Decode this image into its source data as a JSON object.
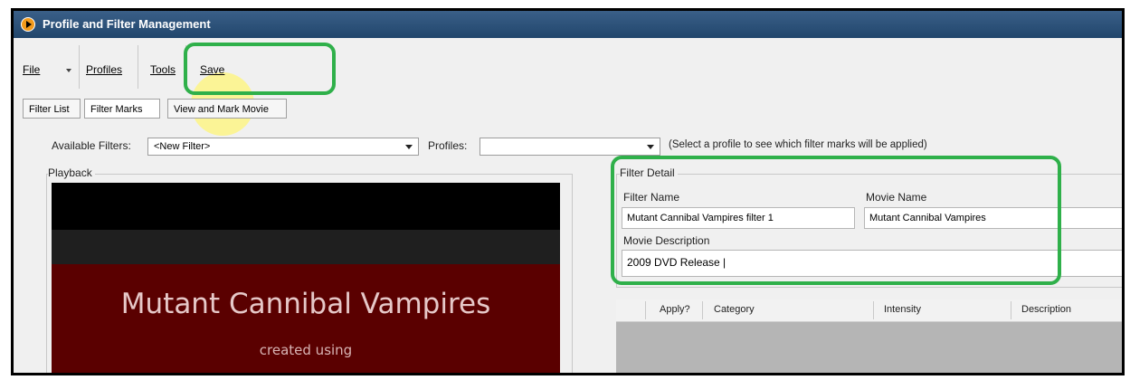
{
  "window": {
    "title": "Profile and Filter Management"
  },
  "menu": {
    "file": "File",
    "profiles": "Profiles",
    "tools": "Tools",
    "save": "Save"
  },
  "tabs": [
    {
      "label": "Filter List"
    },
    {
      "label": "Filter Marks"
    },
    {
      "label": "View and Mark Movie"
    }
  ],
  "filters": {
    "available_label": "Available Filters:",
    "available_value": "<New Filter>",
    "profiles_label": "Profiles:",
    "profiles_value": "",
    "hint": "(Select a profile to see which filter marks will be applied)"
  },
  "playback": {
    "label": "Playback",
    "title": "Mutant Cannibal Vampires",
    "subtitle": "created using"
  },
  "filter_detail": {
    "group_label": "Filter Detail",
    "filter_name_label": "Filter Name",
    "filter_name_value": "Mutant Cannibal Vampires filter 1",
    "movie_name_label": "Movie Name",
    "movie_name_value": "Mutant Cannibal Vampires",
    "movie_desc_label": "Movie Description",
    "movie_desc_value": "2009 DVD Release |"
  },
  "grid": {
    "columns": [
      "Apply?",
      "Category",
      "Intensity",
      "Description"
    ]
  },
  "colors": {
    "annotation_green": "#2fb04a",
    "highlight_yellow": "#fff578",
    "titlebar": "#2b5078"
  }
}
